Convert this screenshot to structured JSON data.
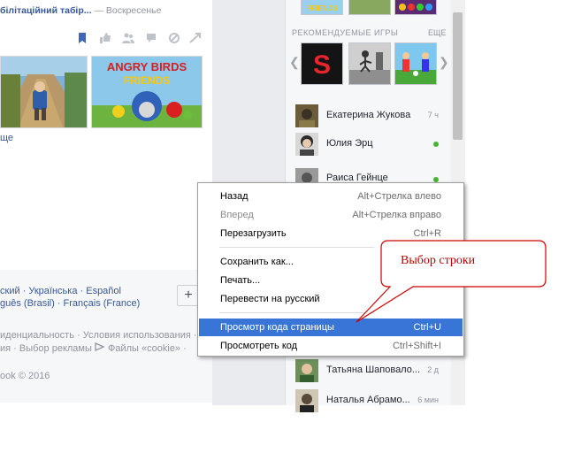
{
  "feed": {
    "post_link": "білітаційний табір...",
    "post_date": "— Воскресенье",
    "more_link": "ще"
  },
  "footer": {
    "lang_line1": "ский · Українська · Español",
    "lang_line2": "guês (Brasil) · Français (France)",
    "plus": "+",
    "links_line1": "иденциальность · Условия использования ·",
    "links_line2": "ия · Выбор рекламы",
    "cookie_link": "Файлы «cookie» ·",
    "copyright": "ook © 2016"
  },
  "sidebar": {
    "games_title": "РЕКОМЕНДУЕМЫЕ ИГРЫ",
    "games_more": "ЕЩЕ",
    "top_game_label": "FRIENDS",
    "friends": [
      {
        "name": "Екатерина Жукова",
        "time": "7 ч",
        "online": false
      },
      {
        "name": "Юлия Эрц",
        "time": "",
        "online": true
      },
      {
        "name": "Раиса Гейнце",
        "time": "",
        "online": true
      },
      {
        "name": "Татьяна Шаповало...",
        "time": "2 д",
        "online": false
      },
      {
        "name": "Наталья Абрамо...",
        "time": "6 мин",
        "online": false
      }
    ]
  },
  "context_menu": {
    "items": [
      {
        "label": "Назад",
        "shortcut": "Alt+Стрелка влево"
      },
      {
        "label": "Вперед",
        "shortcut": "Alt+Стрелка вправо"
      },
      {
        "label": "Перезагрузить",
        "shortcut": "Ctrl+R"
      },
      {
        "label": "Сохранить как...",
        "shortcut": ""
      },
      {
        "label": "Печать...",
        "shortcut": ""
      },
      {
        "label": "Перевести на русский",
        "shortcut": ""
      },
      {
        "label": "Просмотр кода страницы",
        "shortcut": "Ctrl+U"
      },
      {
        "label": "Просмотреть код",
        "shortcut": "Ctrl+Shift+I"
      }
    ]
  },
  "callout": {
    "text": "Выбор строки"
  },
  "colors": {
    "link": "#365899",
    "highlight": "#3875d7",
    "callout_border": "#d00000",
    "online": "#42b72a"
  }
}
